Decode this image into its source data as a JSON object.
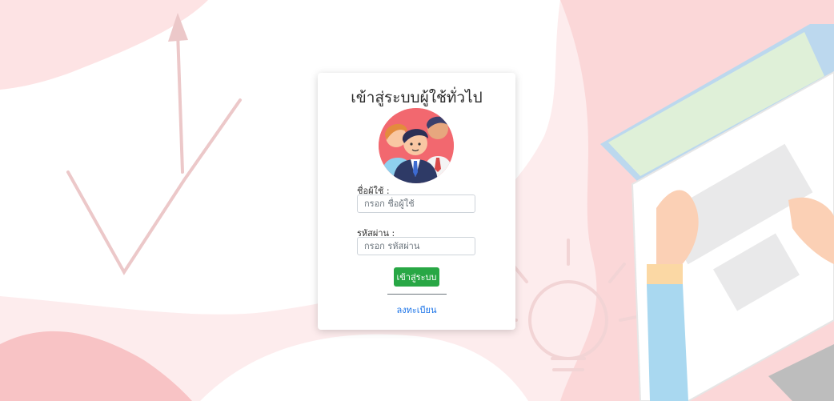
{
  "login": {
    "title": "เข้าสู่ระบบผู้ใช้ทั่วไป",
    "username_label": "ชื่อผู้ใช้ :",
    "username_placeholder": "กรอก ชื่อผู้ใช้",
    "username_value": "",
    "password_label": "รหัสผ่าน :",
    "password_placeholder": "กรอก รหัสผ่าน",
    "password_value": "",
    "submit_label": "เข้าสู่ระบบ",
    "register_label": "ลงทะเบียน"
  },
  "colors": {
    "background": "#fdeced",
    "accent_pink": "#f9c9cb",
    "button": "#28a745",
    "link": "#1a73e8",
    "avatar_bg": "#f2686f"
  },
  "icons": {
    "avatar": "group-users-avatar",
    "background": "laptop-hands-lightbulb-chart-illustration"
  }
}
